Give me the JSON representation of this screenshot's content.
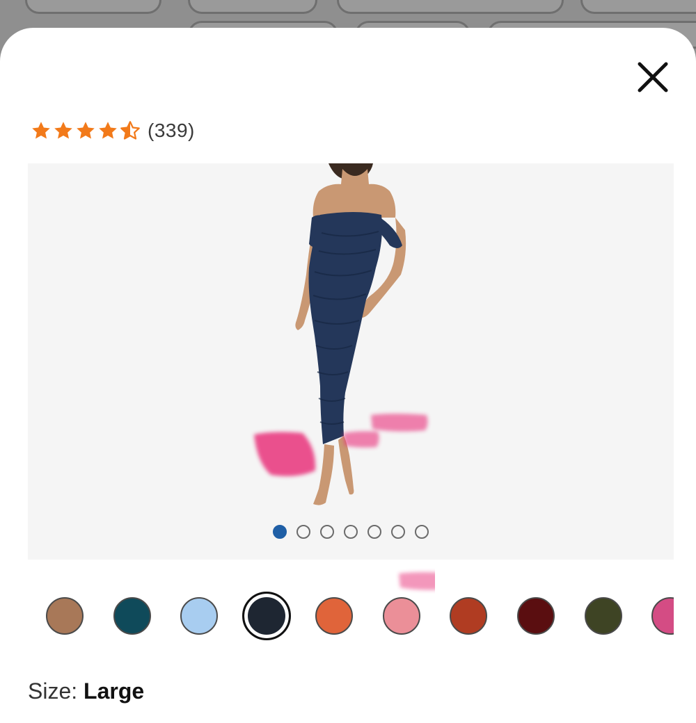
{
  "product": {
    "rating_value": 4.5,
    "rating_count": "(339)"
  },
  "carousel": {
    "image_count": 7,
    "active_index": 0
  },
  "swatches": [
    {
      "name": "color-swatch-brown",
      "color": "#a87858"
    },
    {
      "name": "color-swatch-teal",
      "color": "#0f4a5a"
    },
    {
      "name": "color-swatch-light-blue",
      "color": "#a8cdf0"
    },
    {
      "name": "color-swatch-navy",
      "color": "#1e2632",
      "selected": true
    },
    {
      "name": "color-swatch-orange",
      "color": "#e0643a"
    },
    {
      "name": "color-swatch-pink",
      "color": "#eb8f98"
    },
    {
      "name": "color-swatch-rust",
      "color": "#b03c22"
    },
    {
      "name": "color-swatch-burgundy",
      "color": "#5a0e10"
    },
    {
      "name": "color-swatch-olive",
      "color": "#3e4424"
    },
    {
      "name": "color-swatch-magenta",
      "color": "#d44c84"
    }
  ],
  "size": {
    "label": "Size: ",
    "value": "Large"
  },
  "colors": {
    "star": "#f27a1a",
    "dot_active": "#1f5fa6",
    "dress": "#243656"
  },
  "icons": {
    "close": "close-icon",
    "star": "star-icon"
  }
}
